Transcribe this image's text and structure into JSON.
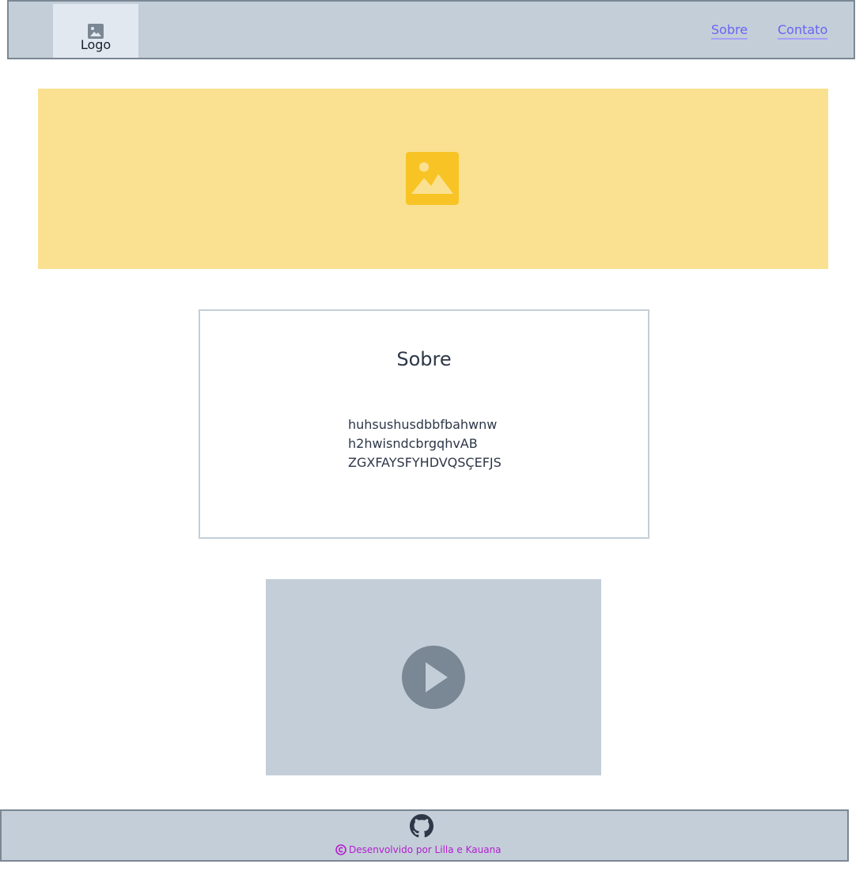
{
  "header": {
    "logo_label": "Logo",
    "nav": [
      {
        "label": "Sobre"
      },
      {
        "label": "Contato"
      }
    ]
  },
  "banner": {
    "icon": "image-placeholder-icon"
  },
  "about": {
    "title": "Sobre",
    "lines": [
      "huhsushusdbbfbahwnw",
      "h2hwisndcbrgqhvAB",
      "ZGXFAYSFYHDVQSÇEFJS"
    ]
  },
  "video": {
    "icon": "play-icon"
  },
  "footer": {
    "icon": "github-icon",
    "credit": "Desenvolvido por Lilla e Kauana"
  },
  "colors": {
    "header_bg": "#c3ced8",
    "banner_bg": "#fae191",
    "banner_icon": "#f8c425",
    "link": "#6b63f4",
    "credit": "#b31fcf",
    "play_button": "#7a8794"
  }
}
